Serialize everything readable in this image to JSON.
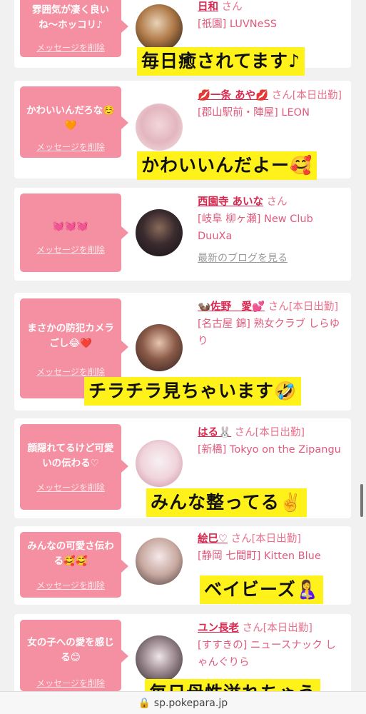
{
  "cards": [
    {
      "bubble_text": "雰囲気が凄く良いね〜ホッコリ♪",
      "delete_label": "メッセージを削除",
      "name": "日和",
      "san": "さん",
      "shop": "[祇園] LUVNeSS",
      "caption": "毎日癒されてます♪"
    },
    {
      "bubble_text": "かわいいんだろな☺️🧡",
      "delete_label": "メッセージを削除",
      "name": "💋一条 あや💋",
      "san": "さん[本日出勤]",
      "shop": "[郡山駅前・陣屋] LEON",
      "caption": "かわいいんだよー🥰"
    },
    {
      "bubble_text": "💓💓💓",
      "delete_label": "メッセージを削除",
      "name": "西園寺 あいな",
      "san": "さん",
      "shop": "[岐阜 柳ヶ瀬] New Club DuuXa",
      "blog": "最新のブログを見る"
    },
    {
      "bubble_text": "まさかの防犯カメラごし😂❤️",
      "delete_label": "メッセージを削除",
      "name": "🦦佐野　愛💕",
      "san": "さん[本日出勤]",
      "shop": "[名古屋 錦] 熟女クラブ しらゆり",
      "caption": "チラチラ見ちゃいます🤣"
    },
    {
      "bubble_text": "顔隠れてるけど可愛いの伝わる♡",
      "delete_label": "メッセージを削除",
      "name": "はる🐰",
      "san": "さん[本日出勤]",
      "shop": "[新橋] Tokyo on the Zipangu",
      "caption": "みんな整ってる✌️"
    },
    {
      "bubble_text": "みんなの可愛さ伝わる🥰🥰",
      "delete_label": "メッセージを削除",
      "name": "絵巳♡",
      "san": "さん[本日出勤]",
      "shop": "[静岡 七間町] Kitten Blue",
      "caption": "ベイビーズ🤱"
    },
    {
      "bubble_text": "女の子への愛を感じる😊",
      "delete_label": "メッセージを削除",
      "name": "ユン長老",
      "san": "さん[本日出勤]",
      "shop": "[すすきの] ニュースナック しゃんぐりら",
      "caption": "毎日母性溢れちゃう"
    }
  ],
  "browser": {
    "url": "🔒 sp.pokepara.jp"
  }
}
